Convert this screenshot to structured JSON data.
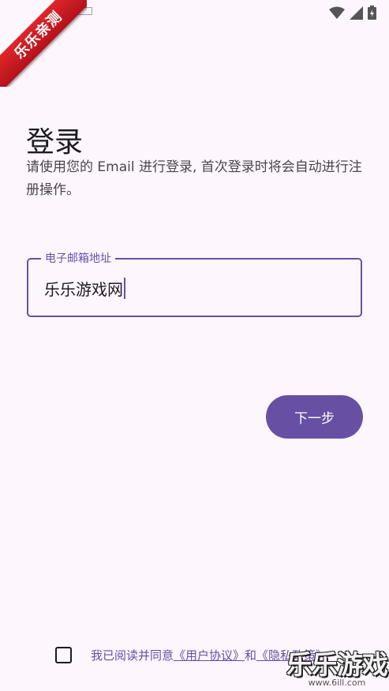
{
  "ribbon": {
    "text": "乐乐亲测"
  },
  "page": {
    "title": "登录",
    "subtitle": "请使用您的 Email 进行登录, 首次登录时将会自动进行注册操作。"
  },
  "email_field": {
    "label": "电子邮箱地址",
    "value": "乐乐游戏网"
  },
  "next_button": {
    "label": "下一步"
  },
  "agreement": {
    "prefix": "我已阅读并同意",
    "user_agreement": "《用户协议》",
    "and": "和",
    "privacy_policy": "《隐私政策》"
  },
  "watermark": {
    "title": "乐乐游戏",
    "url": "www.6ill.com"
  },
  "colors": {
    "accent": "#6750a4",
    "background": "#fdf6fd",
    "ribbon": "#d42026"
  }
}
